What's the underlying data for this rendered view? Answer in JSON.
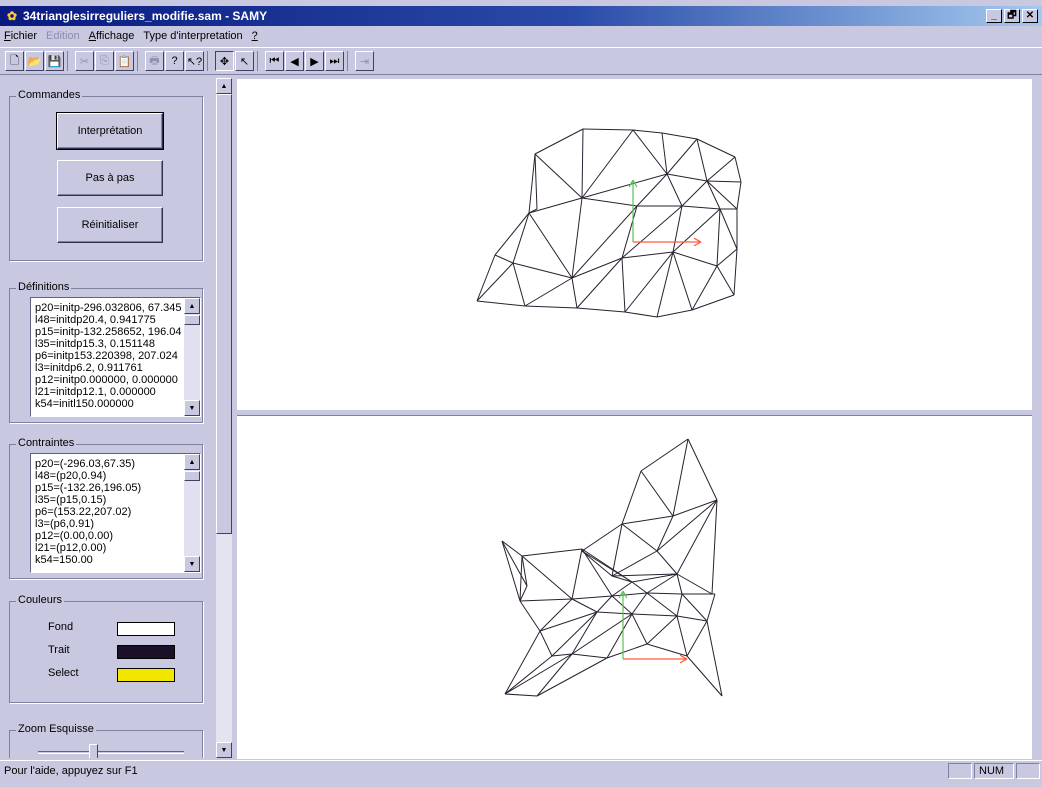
{
  "window": {
    "title": "34trianglesirreguliers_modifie.sam - SAMY",
    "buttons": [
      "_",
      "🗗",
      "✕"
    ]
  },
  "menu": [
    {
      "label": "Fichier",
      "accel": "F",
      "enabled": true
    },
    {
      "label": "Edition",
      "accel": "",
      "enabled": false
    },
    {
      "label": "Affichage",
      "accel": "A",
      "enabled": true
    },
    {
      "label": "Type d'interpretation",
      "accel": "",
      "enabled": true
    },
    {
      "label": "?",
      "accel": "?",
      "enabled": true
    }
  ],
  "toolbar": [
    {
      "name": "new-icon",
      "glyph": "🗋",
      "enabled": true
    },
    {
      "name": "open-icon",
      "glyph": "📂",
      "enabled": true
    },
    {
      "name": "save-icon",
      "glyph": "💾",
      "enabled": true
    },
    {
      "sep": true
    },
    {
      "name": "cut-icon",
      "glyph": "✂",
      "enabled": false
    },
    {
      "name": "copy-icon",
      "glyph": "⎘",
      "enabled": false
    },
    {
      "name": "paste-icon",
      "glyph": "📋",
      "enabled": false
    },
    {
      "sep": true
    },
    {
      "name": "print-icon",
      "glyph": "🖶",
      "enabled": false
    },
    {
      "name": "about-icon",
      "glyph": "?",
      "enabled": true
    },
    {
      "name": "context-help-icon",
      "glyph": "↖?",
      "enabled": true
    },
    {
      "sep": true
    },
    {
      "name": "move-icon",
      "glyph": "✥",
      "enabled": true,
      "pressed": true
    },
    {
      "name": "select-arrow-icon",
      "glyph": "↖",
      "enabled": true
    },
    {
      "sep": true
    },
    {
      "name": "first-icon",
      "glyph": "⏮",
      "enabled": true
    },
    {
      "name": "prev-icon",
      "glyph": "◀",
      "enabled": true
    },
    {
      "name": "next-icon",
      "glyph": "▶",
      "enabled": true
    },
    {
      "name": "last-icon",
      "glyph": "⏭",
      "enabled": true
    },
    {
      "sep": true
    },
    {
      "name": "goto-end-icon",
      "glyph": "⇥",
      "enabled": false
    }
  ],
  "commandes": {
    "title": "Commandes",
    "buttons": [
      "Interprétation",
      "Pas à pas",
      "Réinitialiser"
    ]
  },
  "definitions": {
    "title": "Définitions",
    "lines": [
      "p20=initp-296.032806, 67.345",
      "l48=initdp20.4, 0.941775",
      "p15=initp-132.258652, 196.04",
      "l35=initdp15.3, 0.151148",
      "p6=initp153.220398, 207.024",
      "l3=initdp6.2, 0.911761",
      "p12=initp0.000000, 0.000000",
      "l21=initdp12.1, 0.000000",
      "k54=initl150.000000"
    ]
  },
  "contraintes": {
    "title": "Contraintes",
    "lines": [
      "p20=(-296.03,67.35)",
      "l48=(p20,0.94)",
      "p15=(-132.26,196.05)",
      "l35=(p15,0.15)",
      "p6=(153.22,207.02)",
      "l3=(p6,0.91)",
      "p12=(0.00,0.00)",
      "l21=(p12,0.00)",
      "k54=150.00"
    ]
  },
  "couleurs": {
    "title": "Couleurs",
    "items": [
      {
        "label": "Fond",
        "color": "#ffffff"
      },
      {
        "label": "Trait",
        "color": "#1a1028"
      },
      {
        "label": "Select",
        "color": "#f2e600"
      }
    ]
  },
  "zoom": {
    "title": "Zoom Esquisse",
    "level": 0.38
  },
  "status": {
    "message": "Pour l'aide, appuyez sur F1",
    "panes": [
      "",
      "NUM",
      ""
    ]
  },
  "colors": {
    "line": "#2a2030",
    "axis_x": "#ff5a3c",
    "axis_y": "#5ac05a"
  }
}
